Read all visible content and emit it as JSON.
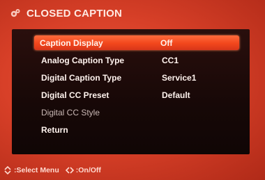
{
  "header": {
    "title": "CLOSED CAPTION",
    "icon": "gear-icon"
  },
  "menu": {
    "items": [
      {
        "label": "Caption Display",
        "value": "Off"
      },
      {
        "label": "Analog  Caption Type",
        "value": "CC1"
      },
      {
        "label": "Digital Caption Type",
        "value": "Service1"
      },
      {
        "label": "Digital CC Preset",
        "value": "Default"
      },
      {
        "label": "Digital CC Style",
        "value": ""
      },
      {
        "label": "Return",
        "value": ""
      }
    ],
    "selected_index": 0
  },
  "footer": {
    "select_hint": ":Select Menu",
    "onoff_hint": ":On/Off",
    "select_icon": "up-down-arrow-icon",
    "onoff_icon": "left-right-arrow-icon"
  },
  "colors": {
    "accent": "#f2471c",
    "background": "#d84028",
    "panel": "#170807"
  }
}
